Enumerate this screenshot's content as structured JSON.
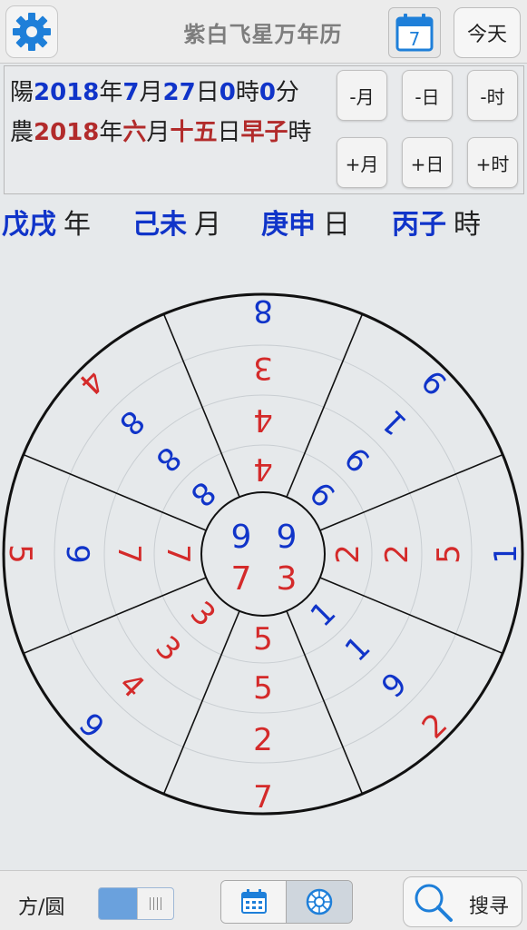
{
  "header": {
    "title": "紫白飞星万年历",
    "calendar_day": "7",
    "today_label": "今天"
  },
  "solar_date": {
    "prefix": "陽",
    "year": "2018",
    "year_unit": "年",
    "month": "7",
    "month_unit": "月",
    "day": "27",
    "day_unit": "日",
    "hour": "0",
    "hour_unit": "時",
    "minute": "0",
    "minute_unit": "分"
  },
  "lunar_date": {
    "prefix": "農",
    "year": "2018",
    "year_unit": "年",
    "month": "六",
    "month_unit": "月",
    "day": "十五",
    "day_unit": "日",
    "hour": "早子",
    "hour_unit": "時"
  },
  "adjust_buttons": {
    "minus_month": "-月",
    "minus_day": "-日",
    "minus_hour": "-时",
    "plus_month": "+月",
    "plus_day": "+日",
    "plus_hour": "+时"
  },
  "ganzhi": {
    "year_stem": "戊戌",
    "year_unit": "年",
    "month_stem": "己未",
    "month_unit": "月",
    "day_stem": "庚申",
    "day_unit": "日",
    "hour_stem": "丙子",
    "hour_unit": "時"
  },
  "center": {
    "top_left": "9",
    "top_right": "9",
    "bottom_left": "7",
    "bottom_right": "3"
  },
  "sectors": [
    {
      "name": "top",
      "numbers": [
        {
          "v": "8",
          "c": "blue"
        },
        {
          "v": "3",
          "c": "red"
        },
        {
          "v": "4",
          "c": "red"
        },
        {
          "v": "4",
          "c": "red"
        }
      ]
    },
    {
      "name": "top-right",
      "numbers": [
        {
          "v": "9",
          "c": "blue"
        },
        {
          "v": "1",
          "c": "blue"
        },
        {
          "v": "9",
          "c": "blue"
        },
        {
          "v": "9",
          "c": "blue"
        }
      ]
    },
    {
      "name": "right",
      "numbers": [
        {
          "v": "1",
          "c": "blue"
        },
        {
          "v": "5",
          "c": "red"
        },
        {
          "v": "2",
          "c": "red"
        },
        {
          "v": "2",
          "c": "red"
        }
      ]
    },
    {
      "name": "bottom-right",
      "numbers": [
        {
          "v": "2",
          "c": "red"
        },
        {
          "v": "9",
          "c": "blue"
        },
        {
          "v": "1",
          "c": "blue"
        },
        {
          "v": "1",
          "c": "blue"
        }
      ]
    },
    {
      "name": "bottom",
      "numbers": [
        {
          "v": "7",
          "c": "red"
        },
        {
          "v": "2",
          "c": "red"
        },
        {
          "v": "5",
          "c": "red"
        },
        {
          "v": "5",
          "c": "red"
        }
      ]
    },
    {
      "name": "bottom-left",
      "numbers": [
        {
          "v": "9",
          "c": "blue"
        },
        {
          "v": "4",
          "c": "red"
        },
        {
          "v": "3",
          "c": "red"
        },
        {
          "v": "3",
          "c": "red"
        }
      ]
    },
    {
      "name": "left",
      "numbers": [
        {
          "v": "5",
          "c": "red"
        },
        {
          "v": "9",
          "c": "blue"
        },
        {
          "v": "7",
          "c": "red"
        },
        {
          "v": "7",
          "c": "red"
        }
      ]
    },
    {
      "name": "top-left",
      "numbers": [
        {
          "v": "4",
          "c": "red"
        },
        {
          "v": "8",
          "c": "blue"
        },
        {
          "v": "8",
          "c": "blue"
        },
        {
          "v": "8",
          "c": "blue"
        }
      ]
    }
  ],
  "colors": {
    "blue": "#1034c9",
    "red": "#d42a2a"
  },
  "bottom_bar": {
    "mode_label": "方/圆",
    "search_label": "搜寻"
  }
}
